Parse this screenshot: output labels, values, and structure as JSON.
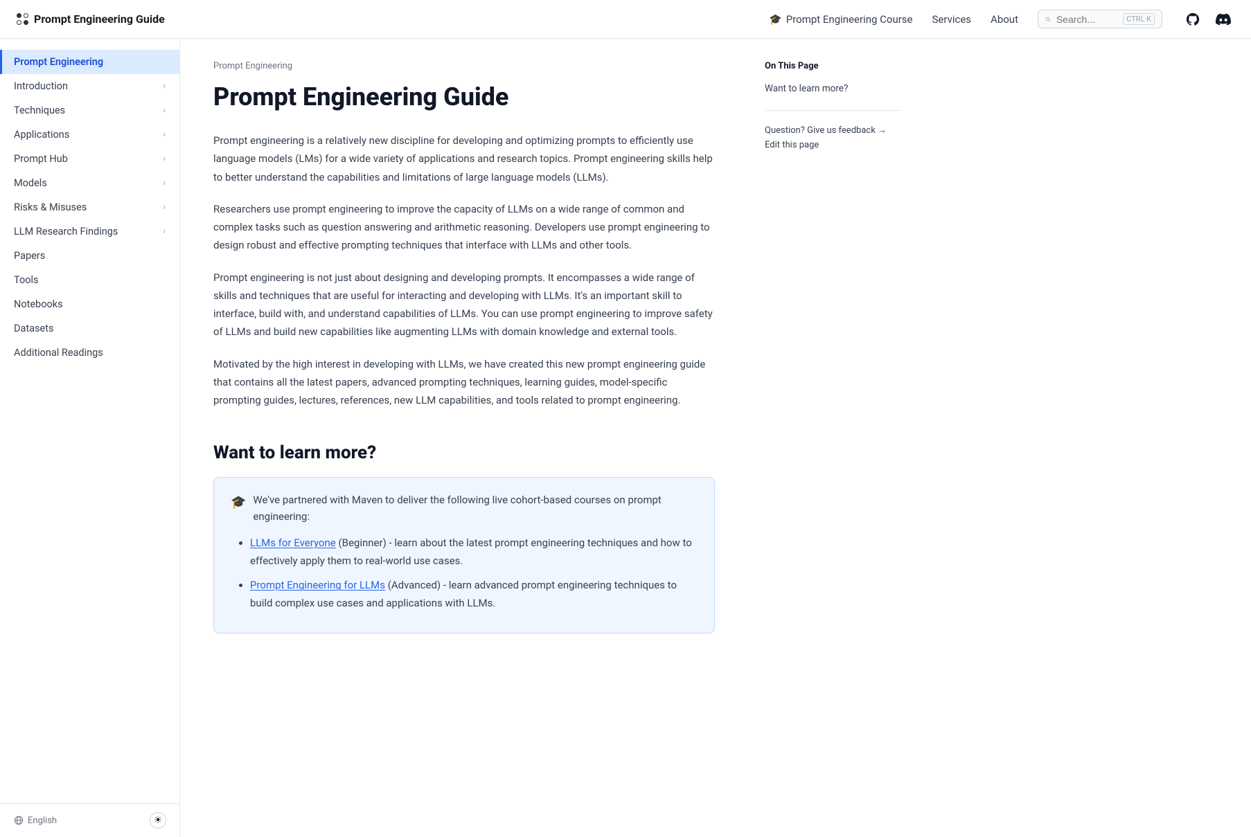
{
  "nav": {
    "logo_text": "Prompt Engineering Guide",
    "course_label": "Prompt Engineering Course",
    "services_label": "Services",
    "about_label": "About",
    "search_placeholder": "Search...",
    "search_kbd": "CTRL K"
  },
  "sidebar": {
    "items": [
      {
        "id": "prompt-engineering",
        "label": "Prompt Engineering",
        "active": true,
        "has_chevron": false
      },
      {
        "id": "introduction",
        "label": "Introduction",
        "active": false,
        "has_chevron": true
      },
      {
        "id": "techniques",
        "label": "Techniques",
        "active": false,
        "has_chevron": true
      },
      {
        "id": "applications",
        "label": "Applications",
        "active": false,
        "has_chevron": true
      },
      {
        "id": "prompt-hub",
        "label": "Prompt Hub",
        "active": false,
        "has_chevron": true
      },
      {
        "id": "models",
        "label": "Models",
        "active": false,
        "has_chevron": true
      },
      {
        "id": "risks-misuses",
        "label": "Risks & Misuses",
        "active": false,
        "has_chevron": true
      },
      {
        "id": "llm-research",
        "label": "LLM Research Findings",
        "active": false,
        "has_chevron": true
      },
      {
        "id": "papers",
        "label": "Papers",
        "active": false,
        "has_chevron": false
      },
      {
        "id": "tools",
        "label": "Tools",
        "active": false,
        "has_chevron": false
      },
      {
        "id": "notebooks",
        "label": "Notebooks",
        "active": false,
        "has_chevron": false
      },
      {
        "id": "datasets",
        "label": "Datasets",
        "active": false,
        "has_chevron": false
      },
      {
        "id": "additional-readings",
        "label": "Additional Readings",
        "active": false,
        "has_chevron": false
      }
    ],
    "footer_lang": "English",
    "footer_theme_icon": "☀"
  },
  "main": {
    "breadcrumb": "Prompt Engineering",
    "title": "Prompt Engineering Guide",
    "paragraphs": [
      "Prompt engineering is a relatively new discipline for developing and optimizing prompts to efficiently use language models (LMs) for a wide variety of applications and research topics. Prompt engineering skills help to better understand the capabilities and limitations of large language models (LLMs).",
      "Researchers use prompt engineering to improve the capacity of LLMs on a wide range of common and complex tasks such as question answering and arithmetic reasoning. Developers use prompt engineering to design robust and effective prompting techniques that interface with LLMs and other tools.",
      "Prompt engineering is not just about designing and developing prompts. It encompasses a wide range of skills and techniques that are useful for interacting and developing with LLMs. It's an important skill to interface, build with, and understand capabilities of LLMs. You can use prompt engineering to improve safety of LLMs and build new capabilities like augmenting LLMs with domain knowledge and external tools.",
      "Motivated by the high interest in developing with LLMs, we have created this new prompt engineering guide that contains all the latest papers, advanced prompting techniques, learning guides, model-specific prompting guides, lectures, references, new LLM capabilities, and tools related to prompt engineering."
    ],
    "section_heading": "Want to learn more?",
    "callout_icon": "🎓",
    "callout_intro": "We've partnered with Maven to deliver the following live cohort-based courses on prompt engineering:",
    "callout_items": [
      {
        "link_text": "LLMs for Everyone",
        "link_suffix": " (Beginner) - learn about the latest prompt engineering techniques and how to effectively apply them to real-world use cases."
      },
      {
        "link_text": "Prompt Engineering for LLMs",
        "link_suffix": " (Advanced) - learn advanced prompt engineering techniques to build complex use cases and applications with LLMs."
      }
    ]
  },
  "toc": {
    "title": "On This Page",
    "links": [
      {
        "label": "Want to learn more?"
      }
    ],
    "feedback_text": "Question? Give us feedback →",
    "edit_text": "Edit this page"
  }
}
